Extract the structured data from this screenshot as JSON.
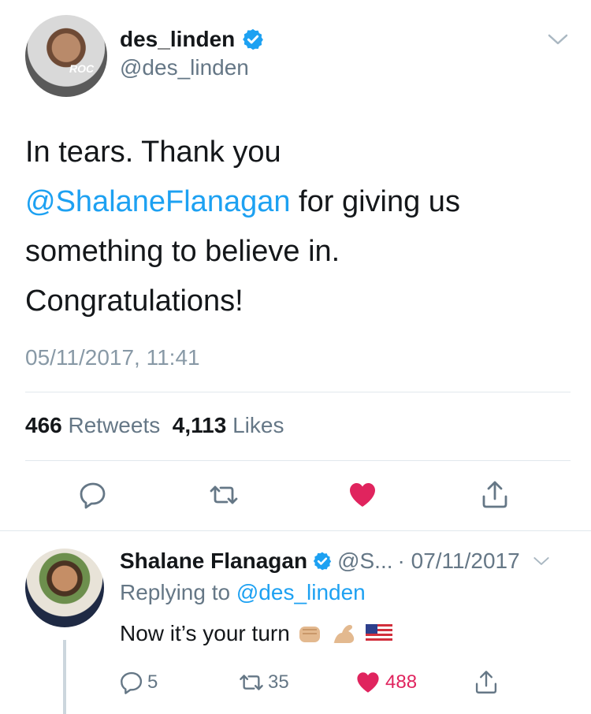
{
  "tweet": {
    "author_name": "des_linden",
    "author_handle": "@des_linden",
    "avatar_logo_text": "ROC",
    "text_part1": "In tears. Thank you",
    "mention": "@ShalaneFlanagan",
    "text_part2": " for giving us something to believe in. Congratulations!",
    "timestamp": "05/11/2017, 11:41",
    "retweets_count": "466",
    "retweets_label": "Retweets",
    "likes_count": "4,113",
    "likes_label": "Likes"
  },
  "actions": [
    "reply-icon",
    "retweet-icon",
    "like-icon-filled",
    "share-icon"
  ],
  "reply": {
    "author_name": "Shalane Flanagan",
    "author_handle_trunc": "@S...",
    "date": "· 07/11/2017",
    "replying_label": "Replying to",
    "replying_to": "@des_linden",
    "text": "Now it’s your turn",
    "reply_count": "5",
    "retweet_count": "35",
    "like_count": "488"
  },
  "colors": {
    "accent": "#1da1f2",
    "like": "#e0245e",
    "muted": "#657786",
    "divider": "#e1e8ed"
  }
}
